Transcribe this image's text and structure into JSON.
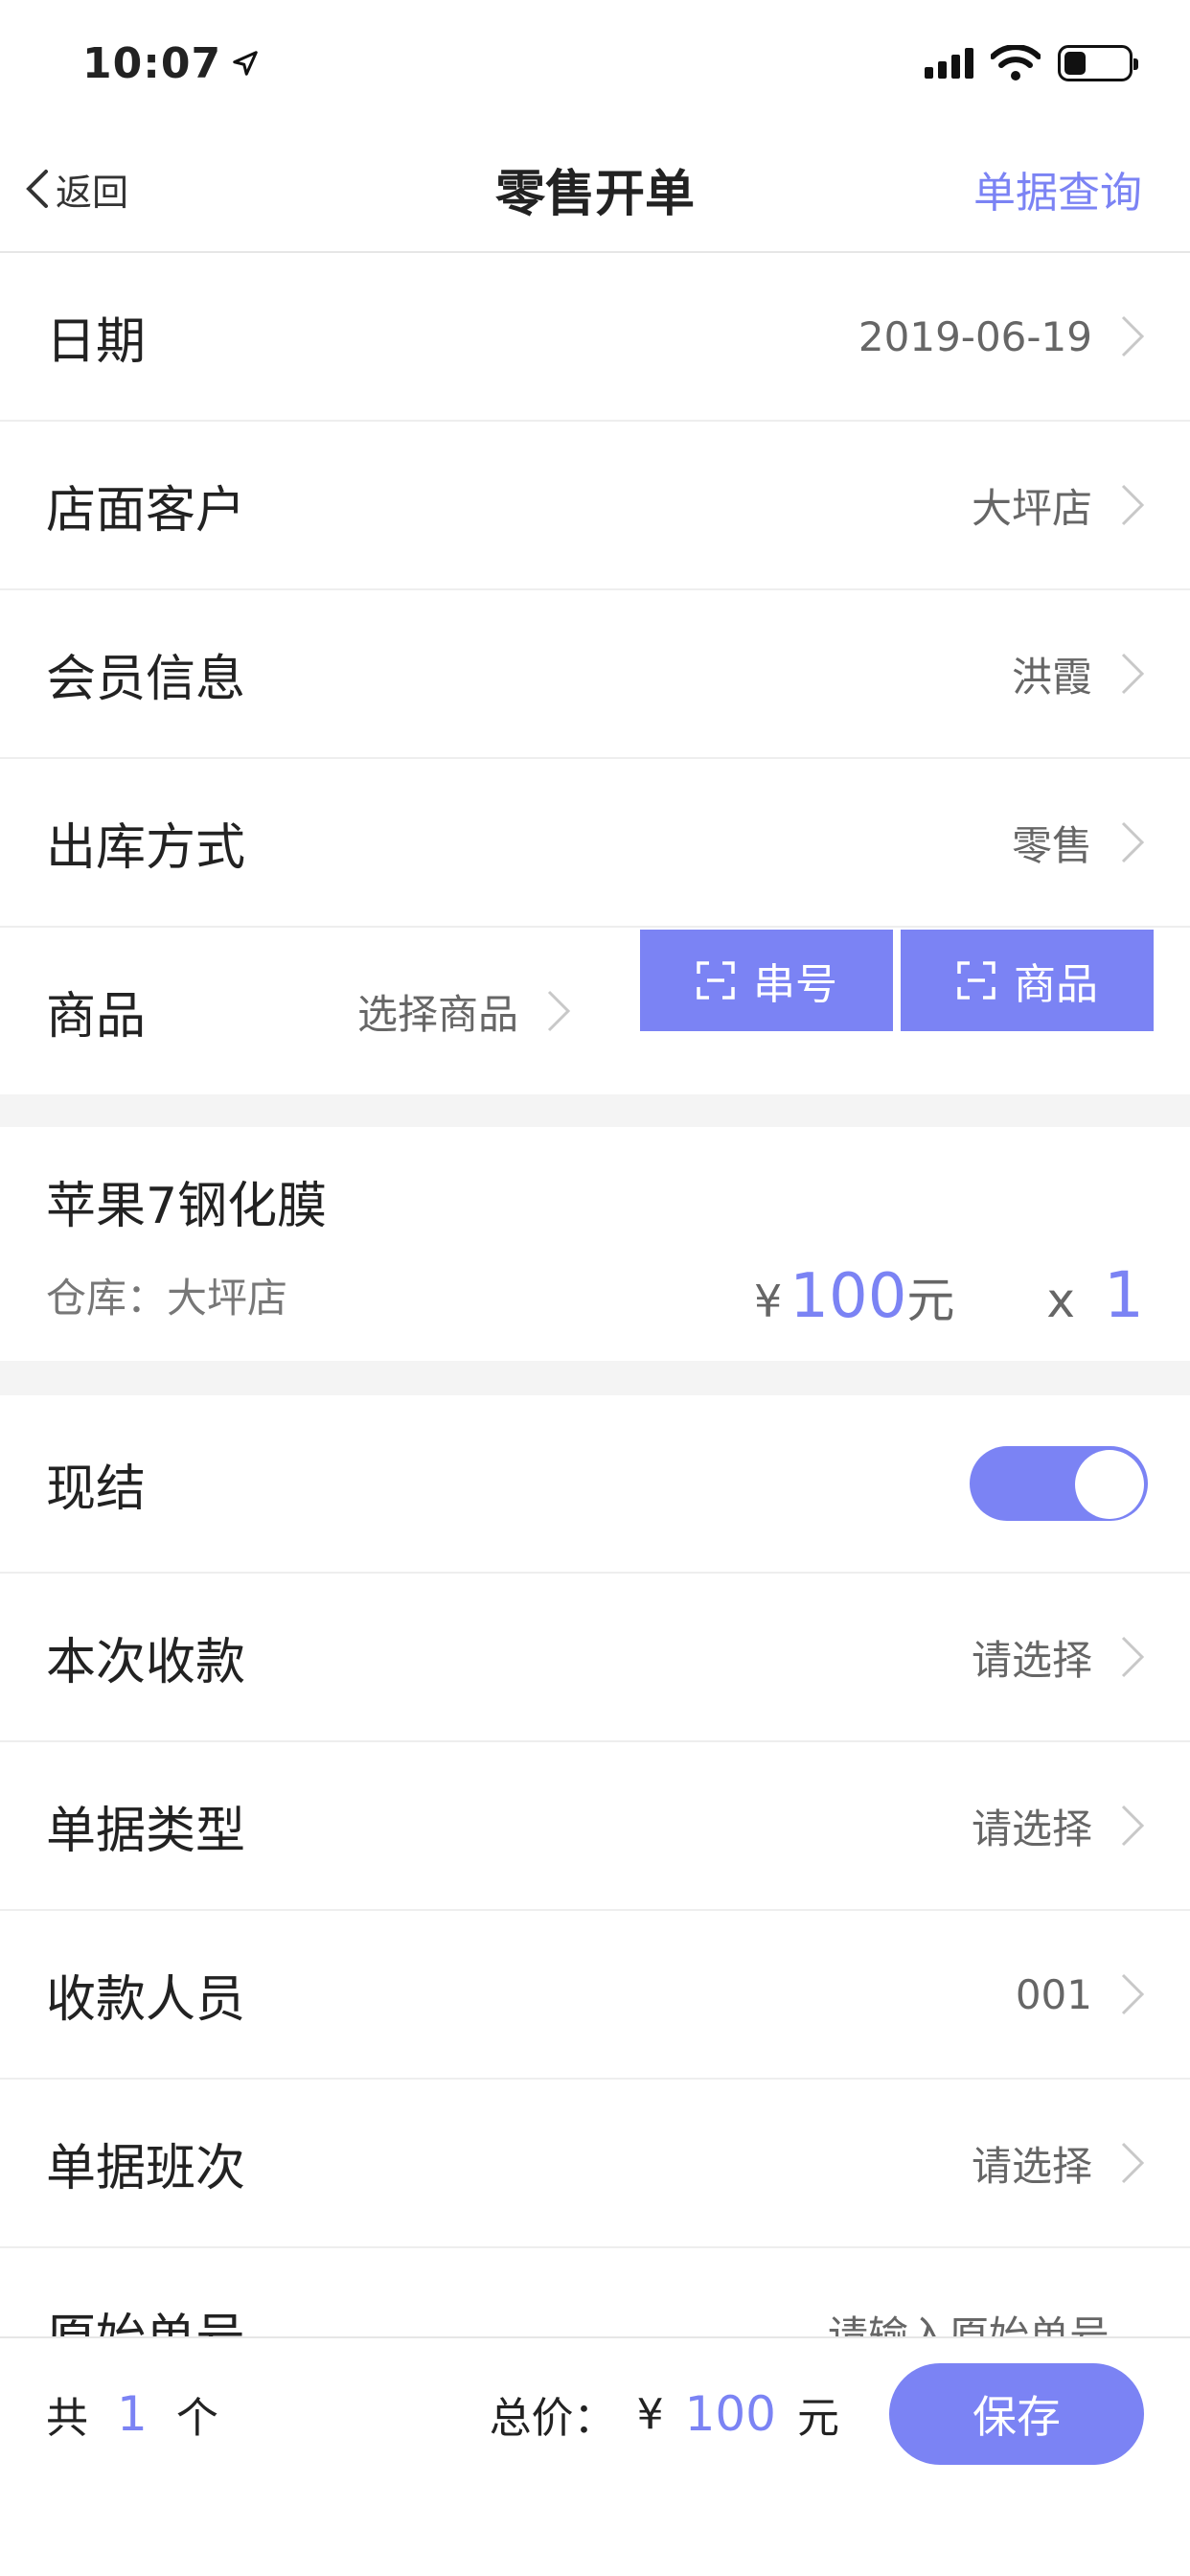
{
  "status_bar": {
    "time": "10:07"
  },
  "nav": {
    "back_label": "返回",
    "title": "零售开单",
    "right_link": "单据查询"
  },
  "rows_top": [
    {
      "label": "日期",
      "value": "2019-06-19"
    },
    {
      "label": "店面客户",
      "value": "大坪店"
    },
    {
      "label": "会员信息",
      "value": "洪霞"
    },
    {
      "label": "出库方式",
      "value": "零售"
    }
  ],
  "product_row": {
    "label": "商品",
    "select_text": "选择商品",
    "scan_serial_label": "串号",
    "scan_product_label": "商品"
  },
  "product_item": {
    "name": "苹果7钢化膜",
    "warehouse": "仓库：大坪店",
    "currency": "¥",
    "price": "100",
    "price_unit": "元",
    "qty_prefix": "x",
    "qty": "1"
  },
  "settle_row": {
    "label": "现结",
    "toggle_on": true
  },
  "rows_bottom": [
    {
      "label": "本次收款",
      "value": "请选择"
    },
    {
      "label": "单据类型",
      "value": "请选择"
    },
    {
      "label": "收款人员",
      "value": "001"
    },
    {
      "label": "单据班次",
      "value": "请选择"
    }
  ],
  "original_no": {
    "label": "原始单号",
    "placeholder": "请输入原始单号"
  },
  "bottom_bar": {
    "count_prefix": "共",
    "count": "1",
    "count_suffix": "个",
    "total_label": "总价：",
    "currency": "¥",
    "total": "100",
    "total_unit": "元",
    "save_label": "保存"
  },
  "colors": {
    "accent": "#7b83f4",
    "text": "#222222",
    "muted": "#666666",
    "divider": "#eeeeee"
  }
}
